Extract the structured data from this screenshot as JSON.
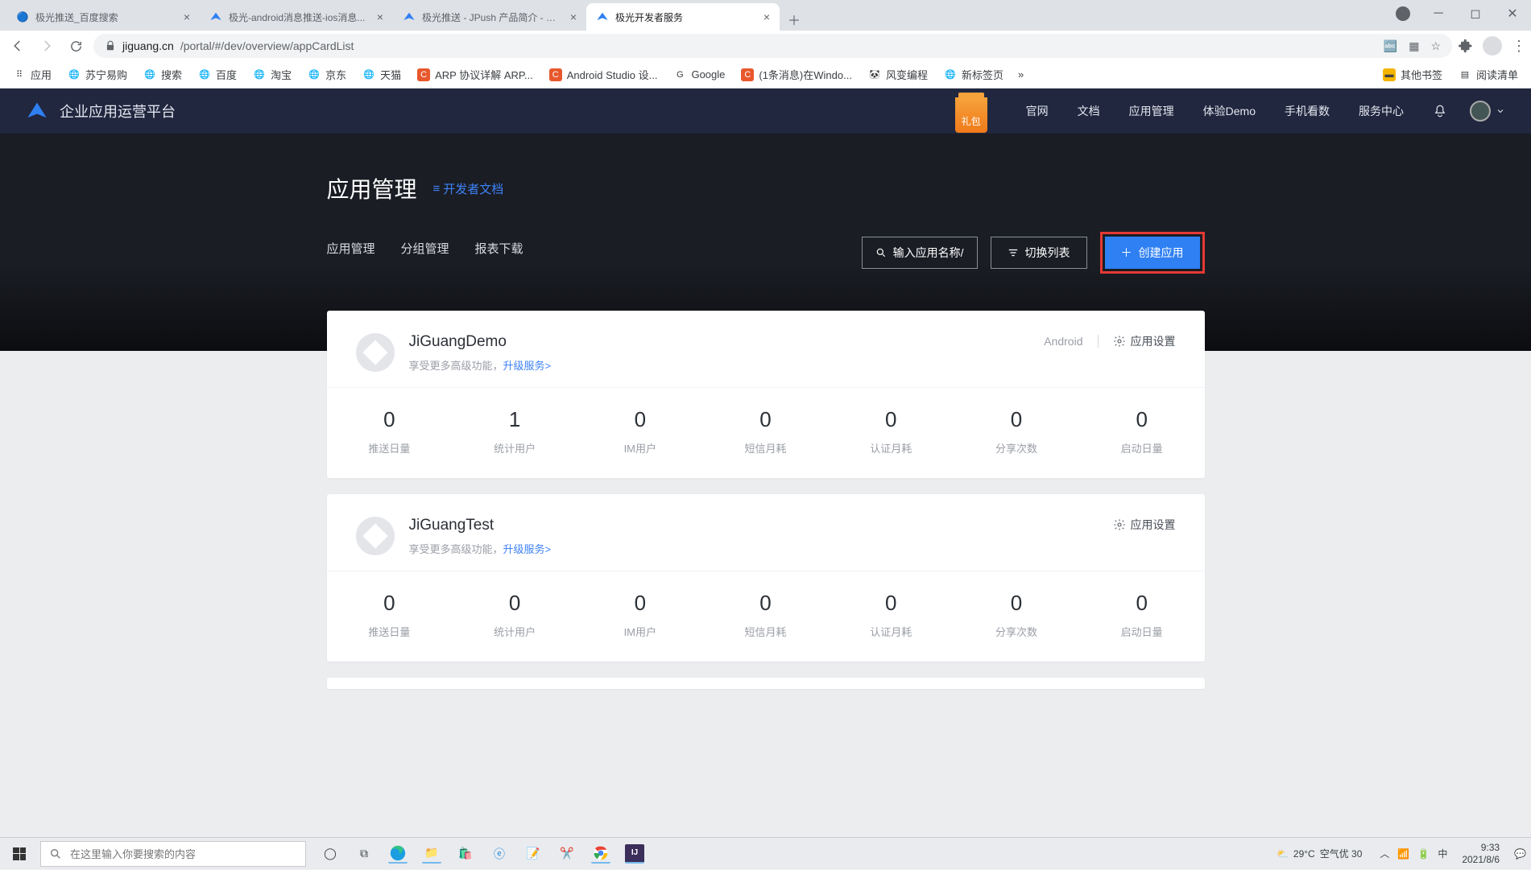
{
  "chrome": {
    "tabs": [
      {
        "title": "极光推送_百度搜索"
      },
      {
        "title": "极光-android消息推送-ios消息..."
      },
      {
        "title": "极光推送 - JPush 产品简介 - 极..."
      },
      {
        "title": "极光开发者服务"
      }
    ],
    "url_host": "jiguang.cn",
    "url_path": "/portal/#/dev/overview/appCardList",
    "bookmarks": {
      "apps": "应用",
      "items": [
        "苏宁易购",
        "搜索",
        "百度",
        "淘宝",
        "京东",
        "天猫"
      ],
      "arp": "ARP 协议详解 ARP...",
      "android_studio": "Android Studio 设...",
      "google": "Google",
      "windows_msg": "(1条消息)在Windo...",
      "fengbian": "风变编程",
      "new_tab": "新标签页",
      "other": "其他书签",
      "reading": "阅读清单"
    }
  },
  "navbar": {
    "title": "企业应用运营平台",
    "gift": "礼包",
    "links": [
      "官网",
      "文档",
      "应用管理",
      "体验Demo",
      "手机看数",
      "服务中心"
    ]
  },
  "hero": {
    "title": "应用管理",
    "doc_link": "开发者文档",
    "sub_tabs": [
      "应用管理",
      "分组管理",
      "报表下载"
    ],
    "search_placeholder": "输入应用名称/",
    "switch_label": "切换列表",
    "create_label": "创建应用"
  },
  "stat_labels": [
    "推送日量",
    "统计用户",
    "IM用户",
    "短信月耗",
    "认证月耗",
    "分享次数",
    "启动日量"
  ],
  "apps": [
    {
      "name": "JiGuangDemo",
      "sub_prefix": "享受更多高级功能，",
      "upgrade": "升级服务>",
      "platform": "Android",
      "settings": "应用设置",
      "stats": [
        "0",
        "1",
        "0",
        "0",
        "0",
        "0",
        "0"
      ]
    },
    {
      "name": "JiGuangTest",
      "sub_prefix": "享受更多高级功能，",
      "upgrade": "升级服务>",
      "platform": "",
      "settings": "应用设置",
      "stats": [
        "0",
        "0",
        "0",
        "0",
        "0",
        "0",
        "0"
      ]
    }
  ],
  "taskbar": {
    "search_placeholder": "在这里输入你要搜索的内容",
    "weather_temp": "29°C",
    "weather_desc": "空气优 30",
    "time": "9:33",
    "date": "2021/8/6"
  }
}
